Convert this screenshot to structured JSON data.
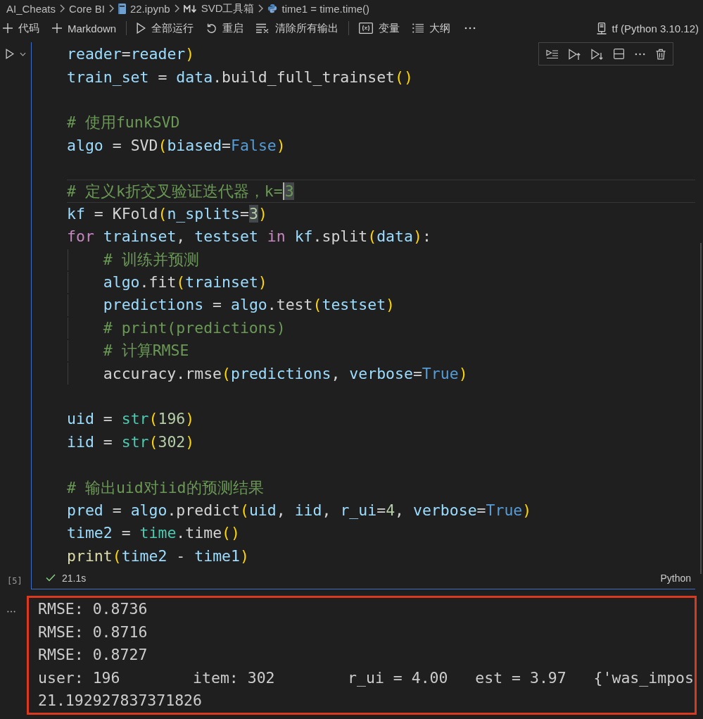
{
  "breadcrumb": [
    {
      "label": "AI_Cheats",
      "kind": "folder"
    },
    {
      "label": "Core BI",
      "kind": "folder"
    },
    {
      "label": "22.ipynb",
      "kind": "notebook"
    },
    {
      "label": "SVD工具箱",
      "kind": "markdown"
    },
    {
      "label": "time1 = time.time()",
      "kind": "python"
    }
  ],
  "toolbar": {
    "groups": [
      [
        {
          "label": "代码",
          "kind": "add"
        },
        {
          "label": "Markdown",
          "kind": "add"
        }
      ],
      [
        {
          "label": "全部运行",
          "kind": "run-all"
        },
        {
          "label": "重启",
          "kind": "restart"
        },
        {
          "label": "清除所有输出",
          "kind": "clear"
        }
      ],
      [
        {
          "label": "变量",
          "kind": "variables"
        },
        {
          "label": "大纲",
          "kind": "outline"
        }
      ]
    ],
    "kernel": "tf (Python 3.10.12)"
  },
  "cell": {
    "focused": true,
    "execution_count": "[5]",
    "succeeded": true,
    "duration": "21.1s",
    "language": "Python",
    "code_blocks": [
      {
        "lines": [
          {
            "current": false,
            "tokens": [
              {
                "text": "reader",
                "kind": "var"
              },
              {
                "text": "=",
                "kind": "op"
              },
              {
                "text": "reader",
                "kind": "var"
              },
              {
                "text": ")",
                "kind": "bracket"
              }
            ]
          },
          {
            "current": false,
            "tokens": [
              {
                "text": "train_set",
                "kind": "var"
              },
              {
                "text": " = ",
                "kind": "op"
              },
              {
                "text": "data",
                "kind": "var"
              },
              {
                "text": ".",
                "kind": "op"
              },
              {
                "text": "build_full_trainset",
                "kind": "plain"
              },
              {
                "text": "()",
                "kind": "bracket"
              }
            ]
          }
        ]
      },
      {
        "lines": [
          {
            "current": false,
            "tokens": [
              {
                "text": "# 使用funkSVD",
                "kind": "comment"
              }
            ]
          },
          {
            "current": false,
            "tokens": [
              {
                "text": "algo",
                "kind": "var"
              },
              {
                "text": " = ",
                "kind": "op"
              },
              {
                "text": "SVD",
                "kind": "plain"
              },
              {
                "text": "(",
                "kind": "bracket"
              },
              {
                "text": "biased",
                "kind": "var"
              },
              {
                "text": "=",
                "kind": "op"
              },
              {
                "text": "False",
                "kind": "const"
              },
              {
                "text": ")",
                "kind": "bracket"
              }
            ]
          }
        ]
      },
      {
        "lines": [
          {
            "current": true,
            "tokens": [
              {
                "text": "# 定义k折交叉验证迭代器，k=",
                "kind": "comment"
              },
              {
                "text": "3",
                "kind": "comment",
                "highlighted": true,
                "cursor": true
              }
            ]
          },
          {
            "current": false,
            "tokens": [
              {
                "text": "kf",
                "kind": "var"
              },
              {
                "text": " = ",
                "kind": "op"
              },
              {
                "text": "KFold",
                "kind": "plain"
              },
              {
                "text": "(",
                "kind": "bracket"
              },
              {
                "text": "n_splits",
                "kind": "var"
              },
              {
                "text": "=",
                "kind": "op"
              },
              {
                "text": "3",
                "kind": "number",
                "highlighted": true
              },
              {
                "text": ")",
                "kind": "bracket"
              }
            ]
          },
          {
            "current": false,
            "tokens": [
              {
                "text": "for ",
                "kind": "keyword"
              },
              {
                "text": "trainset",
                "kind": "var"
              },
              {
                "text": ", ",
                "kind": "op"
              },
              {
                "text": "testset",
                "kind": "var"
              },
              {
                "text": " in ",
                "kind": "keyword"
              },
              {
                "text": "kf",
                "kind": "var"
              },
              {
                "text": ".",
                "kind": "op"
              },
              {
                "text": "split",
                "kind": "plain"
              },
              {
                "text": "(",
                "kind": "bracket"
              },
              {
                "text": "data",
                "kind": "var"
              },
              {
                "text": ")",
                "kind": "bracket"
              },
              {
                "text": ":",
                "kind": "op"
              }
            ],
            "children": [
              {
                "current": false,
                "tokens": [
                  {
                    "text": "# 训练并预测",
                    "kind": "comment"
                  }
                ]
              },
              {
                "current": false,
                "tokens": [
                  {
                    "text": "algo",
                    "kind": "var"
                  },
                  {
                    "text": ".",
                    "kind": "op"
                  },
                  {
                    "text": "fit",
                    "kind": "plain"
                  },
                  {
                    "text": "(",
                    "kind": "bracket"
                  },
                  {
                    "text": "trainset",
                    "kind": "var"
                  },
                  {
                    "text": ")",
                    "kind": "bracket"
                  }
                ]
              },
              {
                "current": false,
                "tokens": [
                  {
                    "text": "predictions",
                    "kind": "var"
                  },
                  {
                    "text": " = ",
                    "kind": "op"
                  },
                  {
                    "text": "algo",
                    "kind": "var"
                  },
                  {
                    "text": ".",
                    "kind": "op"
                  },
                  {
                    "text": "test",
                    "kind": "plain"
                  },
                  {
                    "text": "(",
                    "kind": "bracket"
                  },
                  {
                    "text": "testset",
                    "kind": "var"
                  },
                  {
                    "text": ")",
                    "kind": "bracket"
                  }
                ]
              },
              {
                "current": false,
                "tokens": [
                  {
                    "text": "# print(predictions)",
                    "kind": "comment"
                  }
                ]
              },
              {
                "current": false,
                "tokens": [
                  {
                    "text": "# 计算RMSE",
                    "kind": "comment"
                  }
                ]
              },
              {
                "current": false,
                "tokens": [
                  {
                    "text": "accuracy",
                    "kind": "plain"
                  },
                  {
                    "text": ".",
                    "kind": "op"
                  },
                  {
                    "text": "rmse",
                    "kind": "plain"
                  },
                  {
                    "text": "(",
                    "kind": "bracket"
                  },
                  {
                    "text": "predictions",
                    "kind": "var"
                  },
                  {
                    "text": ", ",
                    "kind": "op"
                  },
                  {
                    "text": "verbose",
                    "kind": "var"
                  },
                  {
                    "text": "=",
                    "kind": "op"
                  },
                  {
                    "text": "True",
                    "kind": "const"
                  },
                  {
                    "text": ")",
                    "kind": "bracket"
                  }
                ]
              }
            ]
          }
        ]
      },
      {
        "lines": [
          {
            "current": false,
            "tokens": [
              {
                "text": "uid",
                "kind": "var"
              },
              {
                "text": " = ",
                "kind": "op"
              },
              {
                "text": "str",
                "kind": "type"
              },
              {
                "text": "(",
                "kind": "bracket"
              },
              {
                "text": "196",
                "kind": "number"
              },
              {
                "text": ")",
                "kind": "bracket"
              }
            ]
          },
          {
            "current": false,
            "tokens": [
              {
                "text": "iid",
                "kind": "var"
              },
              {
                "text": " = ",
                "kind": "op"
              },
              {
                "text": "str",
                "kind": "type"
              },
              {
                "text": "(",
                "kind": "bracket"
              },
              {
                "text": "302",
                "kind": "number"
              },
              {
                "text": ")",
                "kind": "bracket"
              }
            ]
          }
        ]
      },
      {
        "lines": [
          {
            "current": false,
            "tokens": [
              {
                "text": "# 输出uid对iid的预测结果",
                "kind": "comment"
              }
            ]
          },
          {
            "current": false,
            "tokens": [
              {
                "text": "pred",
                "kind": "var"
              },
              {
                "text": " = ",
                "kind": "op"
              },
              {
                "text": "algo",
                "kind": "var"
              },
              {
                "text": ".",
                "kind": "op"
              },
              {
                "text": "predict",
                "kind": "plain"
              },
              {
                "text": "(",
                "kind": "bracket"
              },
              {
                "text": "uid",
                "kind": "var"
              },
              {
                "text": ", ",
                "kind": "op"
              },
              {
                "text": "iid",
                "kind": "var"
              },
              {
                "text": ", ",
                "kind": "op"
              },
              {
                "text": "r_ui",
                "kind": "var"
              },
              {
                "text": "=",
                "kind": "op"
              },
              {
                "text": "4",
                "kind": "number"
              },
              {
                "text": ", ",
                "kind": "op"
              },
              {
                "text": "verbose",
                "kind": "var"
              },
              {
                "text": "=",
                "kind": "op"
              },
              {
                "text": "True",
                "kind": "const"
              },
              {
                "text": ")",
                "kind": "bracket"
              }
            ]
          },
          {
            "current": false,
            "tokens": [
              {
                "text": "time2",
                "kind": "var"
              },
              {
                "text": " = ",
                "kind": "op"
              },
              {
                "text": "time",
                "kind": "type"
              },
              {
                "text": ".",
                "kind": "op"
              },
              {
                "text": "time",
                "kind": "plain"
              },
              {
                "text": "()",
                "kind": "bracket"
              }
            ]
          },
          {
            "current": false,
            "tokens": [
              {
                "text": "print",
                "kind": "func"
              },
              {
                "text": "(",
                "kind": "bracket"
              },
              {
                "text": "time2",
                "kind": "var"
              },
              {
                "text": " - ",
                "kind": "op"
              },
              {
                "text": "time1",
                "kind": "var"
              },
              {
                "text": ")",
                "kind": "bracket"
              }
            ]
          }
        ]
      }
    ]
  },
  "output": {
    "framed": true,
    "lines": [
      "RMSE: 0.8736",
      "RMSE: 0.8716",
      "RMSE: 0.8727",
      "user: 196        item: 302        r_ui = 4.00   est = 3.97   {'was_impos",
      "21.192927837371826"
    ]
  }
}
